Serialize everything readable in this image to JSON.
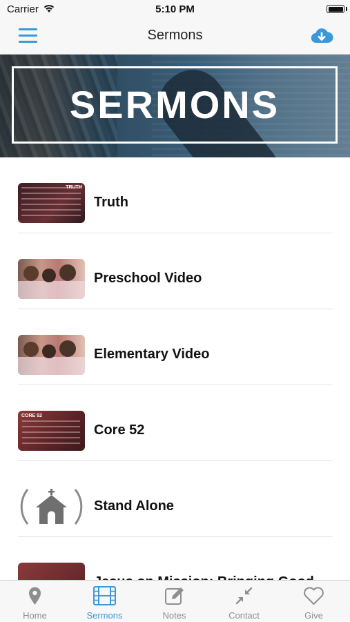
{
  "status_bar": {
    "carrier": "Carrier",
    "time": "5:10 PM"
  },
  "nav": {
    "title": "Sermons"
  },
  "banner": {
    "text": "SERMONS"
  },
  "list": {
    "items": [
      {
        "label": "Truth",
        "thumb_tag": "TRUTH"
      },
      {
        "label": "Preschool Video"
      },
      {
        "label": "Elementary Video"
      },
      {
        "label": "Core 52",
        "thumb_tag": "CORE 52"
      },
      {
        "label": "Stand Alone"
      },
      {
        "label": "Jesus on Mission: Bringing Good News"
      }
    ]
  },
  "tabs": [
    {
      "label": "Home",
      "icon": "map-pin-icon",
      "active": false
    },
    {
      "label": "Sermons",
      "icon": "film-icon",
      "active": true
    },
    {
      "label": "Notes",
      "icon": "edit-icon",
      "active": false
    },
    {
      "label": "Contact",
      "icon": "compress-arrows-icon",
      "active": false
    },
    {
      "label": "Give",
      "icon": "heart-icon",
      "active": false
    }
  ],
  "colors": {
    "accent": "#3a9ad9",
    "inactive": "#8e8e8e"
  }
}
